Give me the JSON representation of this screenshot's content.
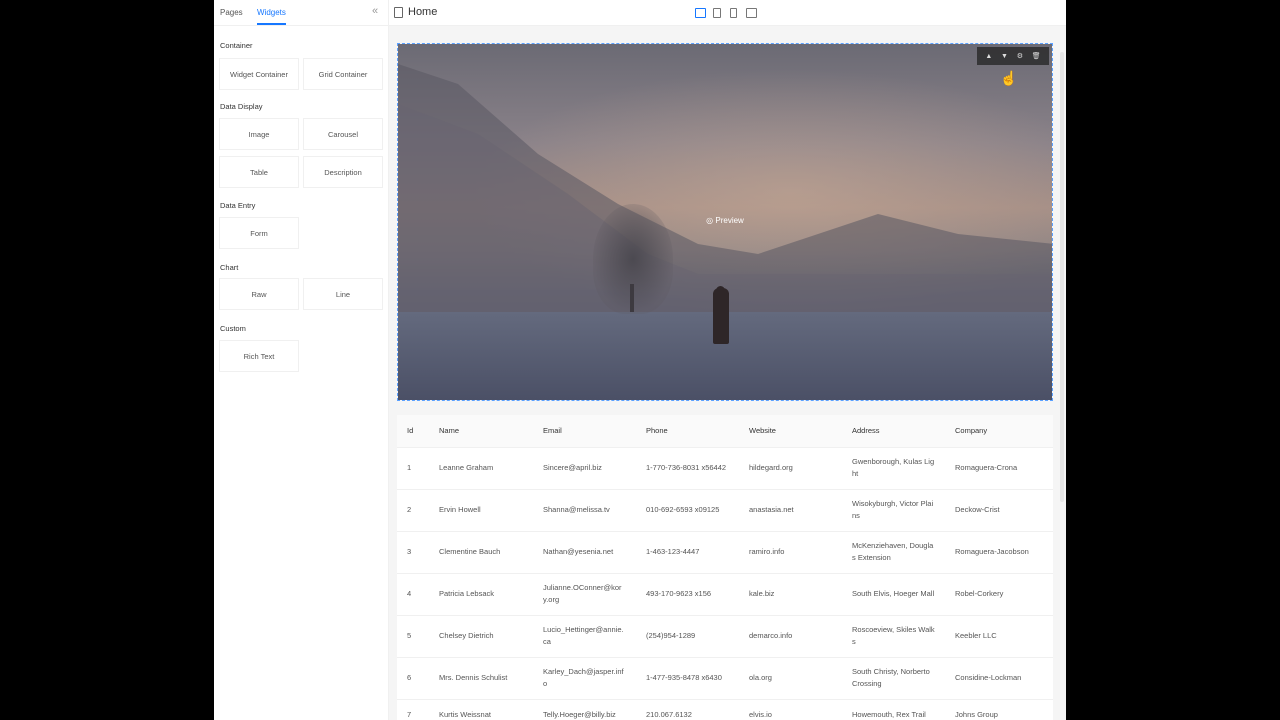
{
  "sidebar": {
    "tabs": [
      "Pages",
      "Widgets"
    ],
    "groups": [
      {
        "title": "Container",
        "items": [
          "Widget Container",
          "Grid Container"
        ]
      },
      {
        "title": "Data Display",
        "items": [
          "Image",
          "Carousel",
          "Table",
          "Description"
        ]
      },
      {
        "title": "Data Entry",
        "items": [
          "Form"
        ]
      },
      {
        "title": "Chart",
        "items": [
          "Raw",
          "Line"
        ]
      },
      {
        "title": "Custom",
        "items": [
          "Rich Text"
        ]
      }
    ],
    "collapse_icon": "double-chevron-left-icon"
  },
  "toolbar": {
    "page_title": "Home",
    "devices": [
      "desktop-icon",
      "tablet-icon",
      "mobile-icon",
      "desktop-tablet-icon"
    ],
    "actions": [
      "save-icon",
      "download-icon",
      "exit-icon"
    ]
  },
  "image_widget": {
    "preview_label": "Preview",
    "tools": [
      "▲",
      "▼",
      "⚙",
      "🗑"
    ]
  },
  "table": {
    "columns": [
      "Id",
      "Name",
      "Email",
      "Phone",
      "Website",
      "Address",
      "Company"
    ],
    "rows": [
      [
        "1",
        "Leanne Graham",
        "Sincere@april.biz",
        "1-770-736-8031 x56442",
        "hildegard.org",
        "Gwenborough, Kulas Light",
        "Romaguera-Crona"
      ],
      [
        "2",
        "Ervin Howell",
        "Shanna@melissa.tv",
        "010-692-6593 x09125",
        "anastasia.net",
        "Wisokyburgh, Victor Plains",
        "Deckow-Crist"
      ],
      [
        "3",
        "Clementine Bauch",
        "Nathan@yesenia.net",
        "1-463-123-4447",
        "ramiro.info",
        "McKenziehaven, Douglas Extension",
        "Romaguera-Jacobson"
      ],
      [
        "4",
        "Patricia Lebsack",
        "Julianne.OConner@kory.org",
        "493-170-9623 x156",
        "kale.biz",
        "South Elvis, Hoeger Mall",
        "Robel-Corkery"
      ],
      [
        "5",
        "Chelsey Dietrich",
        "Lucio_Hettinger@annie.ca",
        "(254)954-1289",
        "demarco.info",
        "Roscoeview, Skiles Walks",
        "Keebler LLC"
      ],
      [
        "6",
        "Mrs. Dennis Schulist",
        "Karley_Dach@jasper.info",
        "1-477-935-8478 x6430",
        "ola.org",
        "South Christy, Norberto Crossing",
        "Considine-Lockman"
      ],
      [
        "7",
        "Kurtis Weissnat",
        "Telly.Hoeger@billy.biz",
        "210.067.6132",
        "elvis.io",
        "Howemouth, Rex Trail",
        "Johns Group"
      ]
    ]
  },
  "colors": {
    "accent": "#1677ff"
  }
}
